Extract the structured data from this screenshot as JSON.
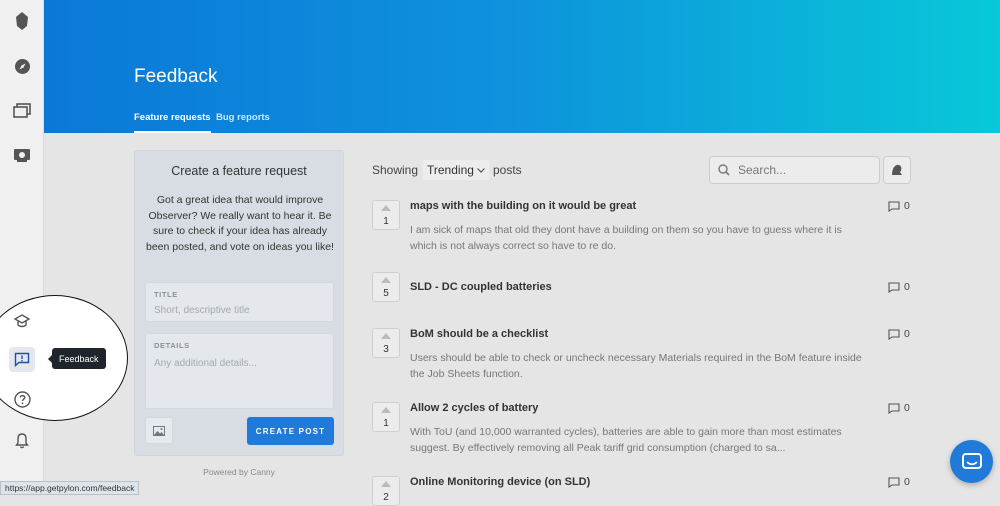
{
  "header": {
    "title": "Feedback",
    "tabs": [
      {
        "label": "Feature requests",
        "active": true
      },
      {
        "label": "Bug reports",
        "active": false
      }
    ],
    "gradient_colors": [
      "#0b78d8",
      "#07c9d8"
    ]
  },
  "sidebar": {
    "icons": [
      "logo-icon",
      "compass-icon",
      "folders-icon",
      "camera-icon",
      "graduation-cap-icon",
      "feedback-icon",
      "help-icon",
      "bell-icon",
      "user-avatar"
    ],
    "tooltip": "Feedback"
  },
  "create_panel": {
    "title": "Create a feature request",
    "description": "Got a great idea that would improve Observer? We really want to hear it. Be sure to check if your idea has already been posted, and vote on ideas you like!",
    "title_field": {
      "label": "TITLE",
      "placeholder": "Short, descriptive title"
    },
    "details_field": {
      "label": "DETAILS",
      "placeholder": "Any additional details..."
    },
    "submit_label": "CREATE POST",
    "powered_by": "Powered by Canny"
  },
  "list": {
    "showing_label": "Showing",
    "sort_value": "Trending",
    "posts_label": "posts",
    "search_placeholder": "Search..."
  },
  "posts": [
    {
      "votes": "1",
      "title": "maps with the building on it would be great",
      "body": "I am sick of maps that old they dont have a building on them so you have to guess where it is which is not always correct so have to re do.",
      "comments": "0"
    },
    {
      "votes": "5",
      "title": "SLD - DC coupled batteries",
      "body": "",
      "comments": "0"
    },
    {
      "votes": "3",
      "title": "BoM should be a checklist",
      "body": "Users should be able to check or uncheck necessary Materials required in the BoM feature inside the Job Sheets function.",
      "comments": "0"
    },
    {
      "votes": "1",
      "title": "Allow 2 cycles of battery",
      "body": "With ToU (and 10,000 warranted cycles), batteries are able to gain more than most estimates suggest. By effectively removing all Peak tariff grid consumption (charged to sa...",
      "comments": "0"
    },
    {
      "votes": "2",
      "title": "Online Monitoring device (on SLD)",
      "body": "",
      "comments": "0"
    }
  ],
  "status_bar": {
    "url": "https://app.getpylon.com/feedback"
  },
  "accent_color": "#1f7ad9"
}
